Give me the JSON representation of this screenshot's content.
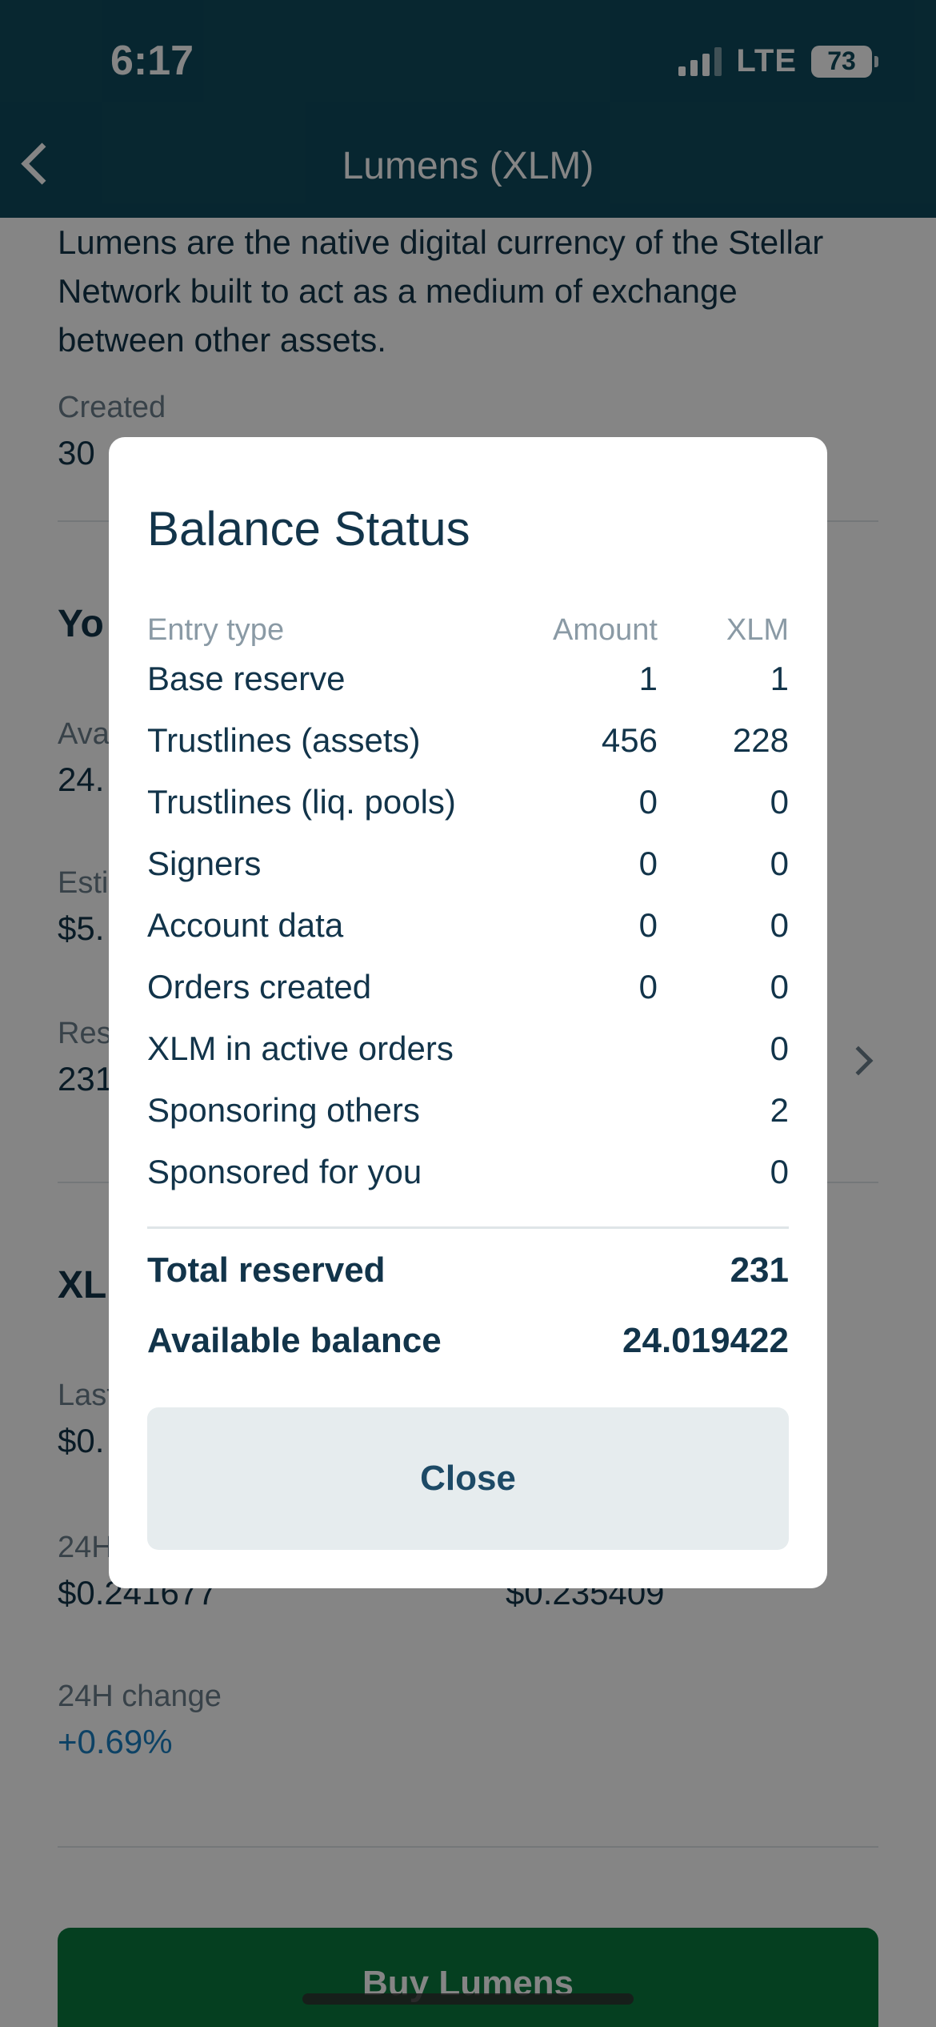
{
  "status_bar": {
    "time": "6:17",
    "network": "LTE",
    "battery": "73"
  },
  "header": {
    "title": "Lumens (XLM)"
  },
  "background": {
    "description": "Lumens are the native digital currency of the Stellar Network built to act as a medium of exchange between other assets.",
    "created_label": "Created",
    "created_value": "30",
    "your_section_title": "Yo",
    "available_label": "Ava",
    "available_value": "24.",
    "estimated_label": "Esti",
    "estimated_value": "$5.",
    "reserved_label": "Res",
    "reserved_value": "231",
    "xlm_section_title": "XL",
    "last_label": "Last",
    "last_value": "$0.",
    "high_label": "24H",
    "high_value": "$0.241677",
    "low_value": "$0.235409",
    "change_label": "24H change",
    "change_value": "+0.69%",
    "buy_button": "Buy Lumens"
  },
  "modal": {
    "title": "Balance Status",
    "columns": [
      "Entry type",
      "Amount",
      "XLM"
    ],
    "rows": [
      {
        "entry": "Base reserve",
        "amount": "1",
        "xlm": "1"
      },
      {
        "entry": "Trustlines (assets)",
        "amount": "456",
        "xlm": "228"
      },
      {
        "entry": "Trustlines (liq. pools)",
        "amount": "0",
        "xlm": "0"
      },
      {
        "entry": "Signers",
        "amount": "0",
        "xlm": "0"
      },
      {
        "entry": "Account data",
        "amount": "0",
        "xlm": "0"
      },
      {
        "entry": "Orders created",
        "amount": "0",
        "xlm": "0"
      },
      {
        "entry": "XLM in active orders",
        "amount": "",
        "xlm": "0"
      },
      {
        "entry": "Sponsoring others",
        "amount": "",
        "xlm": "2"
      },
      {
        "entry": "Sponsored for you",
        "amount": "",
        "xlm": "0"
      }
    ],
    "total_reserved_label": "Total reserved",
    "total_reserved_value": "231",
    "available_balance_label": "Available balance",
    "available_balance_value": "24.019422",
    "close_button": "Close"
  },
  "colors": {
    "header_bg": "#0f4a5c",
    "buy_button_bg": "#0a7a3e",
    "change_positive": "#1a7fc1",
    "close_button_bg": "#e6ecee"
  }
}
